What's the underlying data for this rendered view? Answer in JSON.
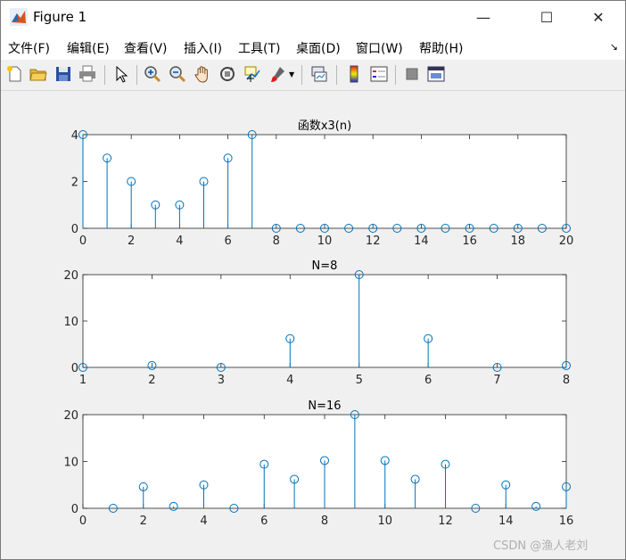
{
  "window": {
    "title": "Figure 1",
    "minimize": "—",
    "maximize": "☐",
    "close": "✕"
  },
  "menu": [
    "文件(F)",
    "编辑(E)",
    "查看(V)",
    "插入(I)",
    "工具(T)",
    "桌面(D)",
    "窗口(W)",
    "帮助(H)"
  ],
  "toolbar": [
    "new-figure-icon",
    "open-file-icon",
    "save-icon",
    "print-icon",
    "select-arrow-icon",
    "zoom-in-icon",
    "zoom-out-icon",
    "pan-hand-icon",
    "rotate-3d-icon",
    "data-cursor-icon",
    "brush-icon",
    "link-plot-icon",
    "colorbar-icon",
    "legend-icon",
    "hide-tools-icon",
    "dock-figure-icon"
  ],
  "colors": {
    "stem": "#0072BD",
    "axes_bg": "#ffffff",
    "axes_line": "#262626"
  },
  "chart_data": [
    {
      "type": "stem",
      "title": "函数x3(n)",
      "x": [
        0,
        1,
        2,
        3,
        4,
        5,
        6,
        7,
        8,
        9,
        10,
        11,
        12,
        13,
        14,
        15,
        16,
        17,
        18,
        19,
        20
      ],
      "y": [
        4,
        3,
        2,
        1,
        1,
        2,
        3,
        4,
        0,
        0,
        0,
        0,
        0,
        0,
        0,
        0,
        0,
        0,
        0,
        0,
        0
      ],
      "xlim": [
        0,
        20
      ],
      "ylim": [
        0,
        4
      ],
      "xticks": [
        0,
        2,
        4,
        6,
        8,
        10,
        12,
        14,
        16,
        18,
        20
      ],
      "yticks": [
        0,
        2,
        4
      ]
    },
    {
      "type": "stem",
      "title": "N=8",
      "x": [
        1,
        2,
        3,
        4,
        5,
        6,
        7,
        8
      ],
      "y": [
        0,
        0.4,
        0,
        6.2,
        20,
        6.2,
        0,
        0.4
      ],
      "xlim": [
        1,
        8
      ],
      "ylim": [
        0,
        20
      ],
      "xticks": [
        1,
        2,
        3,
        4,
        5,
        6,
        7,
        8
      ],
      "yticks": [
        0,
        10,
        20
      ]
    },
    {
      "type": "stem",
      "title": "N=16",
      "x": [
        1,
        2,
        3,
        4,
        5,
        6,
        7,
        8,
        9,
        10,
        11,
        12,
        13,
        14,
        15,
        16
      ],
      "y": [
        0,
        4.6,
        0.4,
        5,
        0,
        9.4,
        6.2,
        10.2,
        20,
        10.2,
        6.2,
        9.4,
        0,
        5,
        0.4,
        4.6
      ],
      "xlim": [
        0,
        16
      ],
      "ylim": [
        0,
        20
      ],
      "xticks": [
        0,
        2,
        4,
        6,
        8,
        10,
        12,
        14,
        16
      ],
      "yticks": [
        0,
        10,
        20
      ]
    }
  ],
  "watermark": "CSDN @渔人老刘"
}
